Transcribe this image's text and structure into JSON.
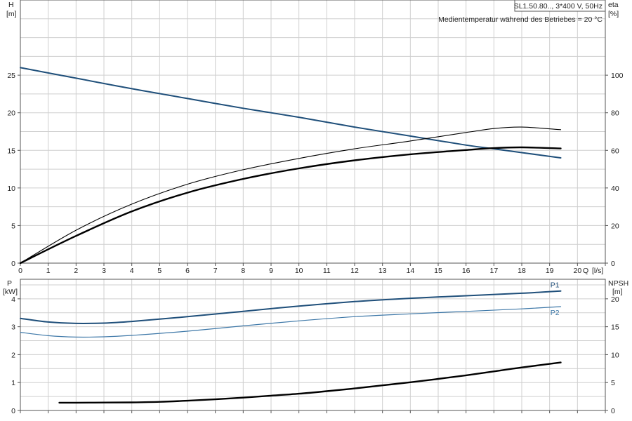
{
  "colors": {
    "grid": "#cfcfcf",
    "axis": "#555555",
    "blue": "#1f4f7a",
    "blue_light": "#3e78a8",
    "black": "#000000"
  },
  "header": {
    "model": "SL1.50.80.., 3*400 V, 50Hz",
    "temperature_note": "Medientemperatur während des Betriebes = 20 °C"
  },
  "chart_data": [
    {
      "type": "line",
      "title": "",
      "xlabel": "Q [l/s]",
      "x_axis": {
        "label": "Q",
        "unit": "[l/s]",
        "min": 0,
        "max": 21,
        "ticks": [
          0,
          1,
          2,
          3,
          4,
          5,
          6,
          7,
          8,
          9,
          10,
          11,
          12,
          13,
          14,
          15,
          16,
          17,
          18,
          19,
          20
        ]
      },
      "y_axis_left": {
        "label": "H",
        "unit": "[m]",
        "min": 0,
        "max": 35,
        "ticks": [
          0,
          5,
          10,
          15,
          20,
          25
        ]
      },
      "y_axis_right": {
        "label": "eta",
        "unit": "[%]",
        "min": 0,
        "max": 140,
        "ticks": [
          0,
          20,
          40,
          60,
          80,
          100
        ]
      },
      "grid": true,
      "series": [
        {
          "axis": "left",
          "style": "blue",
          "x": [
            0,
            2,
            4,
            6,
            8,
            10,
            12,
            14,
            16,
            17,
            18,
            19.4
          ],
          "y": [
            26,
            24.6,
            23.2,
            21.9,
            20.6,
            19.4,
            18.1,
            16.9,
            15.7,
            15.2,
            14.7,
            14
          ]
        },
        {
          "axis": "right",
          "style": "thin",
          "x": [
            0,
            2,
            4,
            6,
            8,
            10,
            12,
            14,
            16,
            17,
            18,
            19.4
          ],
          "y": [
            0,
            17.5,
            31.4,
            42,
            49.7,
            55.7,
            60.8,
            65,
            69.5,
            71.6,
            72.4,
            71
          ]
        },
        {
          "axis": "right",
          "style": "thick",
          "x": [
            0,
            2,
            4,
            6,
            8,
            10,
            12,
            14,
            16,
            17,
            18,
            19.4
          ],
          "y": [
            0,
            14.5,
            27.5,
            37.5,
            44.8,
            50.4,
            54.7,
            57.9,
            60.2,
            61.2,
            61.6,
            61
          ]
        }
      ]
    },
    {
      "type": "line",
      "title": "",
      "y_axis_left": {
        "label": "P",
        "unit": "[kW]",
        "min": 0,
        "max": 4.7,
        "ticks": [
          0,
          1,
          2,
          3,
          4
        ]
      },
      "y_axis_right": {
        "label": "NPSH",
        "unit": "[m]",
        "min": 0,
        "max": 23.5,
        "ticks": [
          0,
          5,
          10,
          15,
          20
        ]
      },
      "x_axis": {
        "min": 0,
        "max": 21
      },
      "grid": true,
      "series": [
        {
          "name": "P1",
          "axis": "left",
          "style": "blue",
          "x": [
            0,
            1,
            2,
            3,
            4,
            6,
            8,
            10,
            12,
            14,
            16,
            18,
            19.4
          ],
          "y": [
            3.3,
            3.17,
            3.12,
            3.13,
            3.19,
            3.36,
            3.55,
            3.74,
            3.9,
            4.02,
            4.11,
            4.2,
            4.28
          ]
        },
        {
          "name": "P2",
          "axis": "left",
          "style": "blue_light",
          "x": [
            0,
            1,
            2,
            3,
            4,
            6,
            8,
            10,
            12,
            14,
            16,
            18,
            19.4
          ],
          "y": [
            2.8,
            2.68,
            2.63,
            2.64,
            2.69,
            2.84,
            3.03,
            3.21,
            3.36,
            3.46,
            3.55,
            3.64,
            3.72
          ]
        },
        {
          "axis": "right",
          "style": "thick",
          "x": [
            1.4,
            2,
            3,
            4,
            5,
            6,
            7,
            8,
            9,
            10,
            11,
            12,
            13,
            14,
            15,
            16,
            17,
            18,
            19.4
          ],
          "y": [
            1.4,
            1.4,
            1.42,
            1.45,
            1.55,
            1.75,
            2.0,
            2.3,
            2.65,
            3.0,
            3.45,
            3.95,
            4.5,
            5.05,
            5.65,
            6.3,
            7.0,
            7.7,
            8.6
          ]
        }
      ]
    }
  ]
}
